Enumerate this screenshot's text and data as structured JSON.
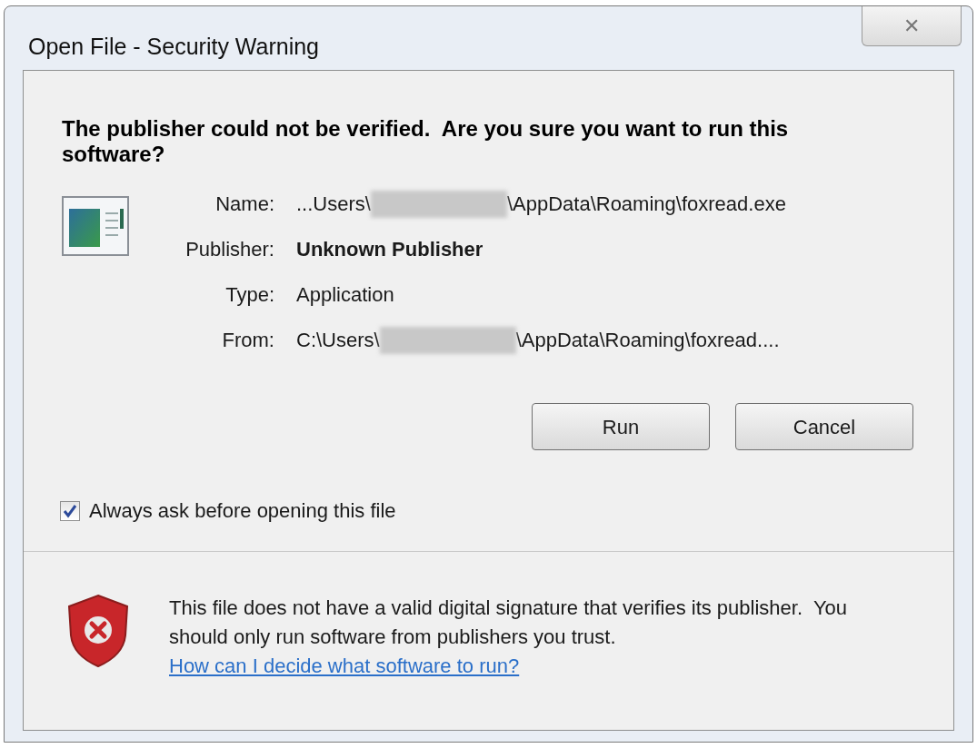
{
  "window": {
    "title": "Open File - Security Warning",
    "close_label": "✕"
  },
  "heading": "The publisher could not be verified.  Are you sure you want to run this software?",
  "fields": [
    {
      "label": "Name:",
      "value_start": "...Users\\",
      "value_end": "\\AppData\\Roaming\\foxread.exe",
      "redacted": true,
      "bold": false
    },
    {
      "label": "Publisher:",
      "value_start": "Unknown Publisher",
      "redacted": false,
      "bold": true
    },
    {
      "label": "Type:",
      "value_start": "Application",
      "redacted": false,
      "bold": false
    },
    {
      "label": "From:",
      "value_start": "C:\\Users\\",
      "value_end": "\\AppData\\Roaming\\foxread....",
      "redacted": true,
      "bold": false
    }
  ],
  "buttons": [
    "Run",
    "Cancel"
  ],
  "checkbox": {
    "label": "Always ask before opening this file",
    "checked": true
  },
  "footer": {
    "text": "This file does not have a valid digital signature that verifies its publisher.  You should only run software from publishers you trust.",
    "link": "How can I decide what software to run?"
  }
}
